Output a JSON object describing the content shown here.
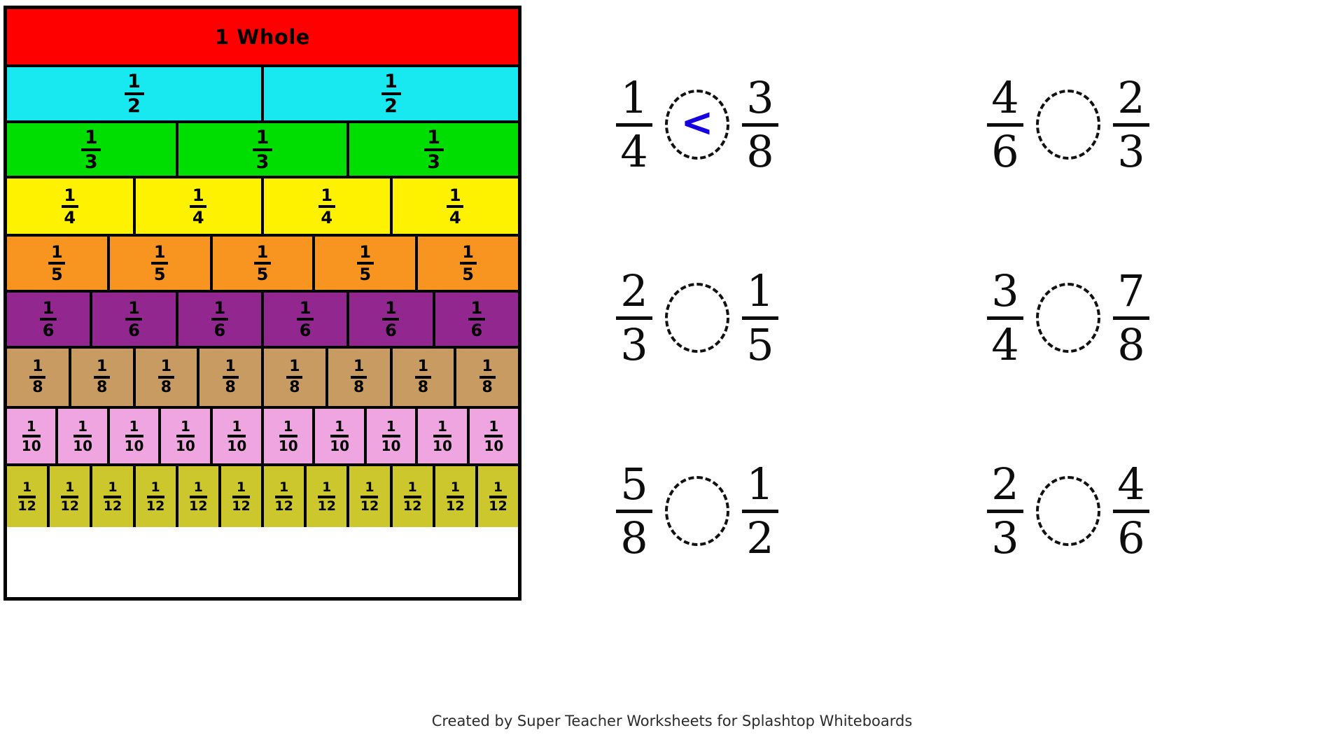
{
  "fraction_chart": {
    "title_row": {
      "label": "1 Whole",
      "color": "#FF0000"
    },
    "rows": [
      {
        "denominator": 2,
        "label": "1/2",
        "numerator": "1",
        "den_text": "2",
        "count": 2,
        "color": "#18E8F0"
      },
      {
        "denominator": 3,
        "label": "1/3",
        "numerator": "1",
        "den_text": "3",
        "count": 3,
        "color": "#00DD00"
      },
      {
        "denominator": 4,
        "label": "1/4",
        "numerator": "1",
        "den_text": "4",
        "count": 4,
        "color": "#FFF200"
      },
      {
        "denominator": 5,
        "label": "1/5",
        "numerator": "1",
        "den_text": "5",
        "count": 5,
        "color": "#F89521"
      },
      {
        "denominator": 6,
        "label": "1/6",
        "numerator": "1",
        "den_text": "6",
        "count": 6,
        "color": "#92278F"
      },
      {
        "denominator": 8,
        "label": "1/8",
        "numerator": "1",
        "den_text": "8",
        "count": 8,
        "color": "#C89B62"
      },
      {
        "denominator": 10,
        "label": "1/10",
        "numerator": "1",
        "den_text": "10",
        "count": 10,
        "color": "#EFA5DF"
      },
      {
        "denominator": 12,
        "label": "1/12",
        "numerator": "1",
        "den_text": "12",
        "count": 12,
        "color": "#CBC72C"
      }
    ]
  },
  "problems": [
    {
      "id": "p1",
      "left": {
        "numerator": "1",
        "denominator": "4"
      },
      "right": {
        "numerator": "3",
        "denominator": "8"
      },
      "answer": "<",
      "answer_color": "#1500E0"
    },
    {
      "id": "p2",
      "left": {
        "numerator": "4",
        "denominator": "6"
      },
      "right": {
        "numerator": "2",
        "denominator": "3"
      },
      "answer": "",
      "answer_color": "#1500E0"
    },
    {
      "id": "p3",
      "left": {
        "numerator": "2",
        "denominator": "3"
      },
      "right": {
        "numerator": "1",
        "denominator": "5"
      },
      "answer": "",
      "answer_color": "#1500E0"
    },
    {
      "id": "p4",
      "left": {
        "numerator": "3",
        "denominator": "4"
      },
      "right": {
        "numerator": "7",
        "denominator": "8"
      },
      "answer": "",
      "answer_color": "#1500E0"
    },
    {
      "id": "p5",
      "left": {
        "numerator": "5",
        "denominator": "8"
      },
      "right": {
        "numerator": "1",
        "denominator": "2"
      },
      "answer": "",
      "answer_color": "#1500E0"
    },
    {
      "id": "p6",
      "left": {
        "numerator": "2",
        "denominator": "3"
      },
      "right": {
        "numerator": "4",
        "denominator": "6"
      },
      "answer": "",
      "answer_color": "#1500E0"
    }
  ],
  "footer": {
    "credit": "Created by Super Teacher Worksheets for Splashtop Whiteboards"
  }
}
